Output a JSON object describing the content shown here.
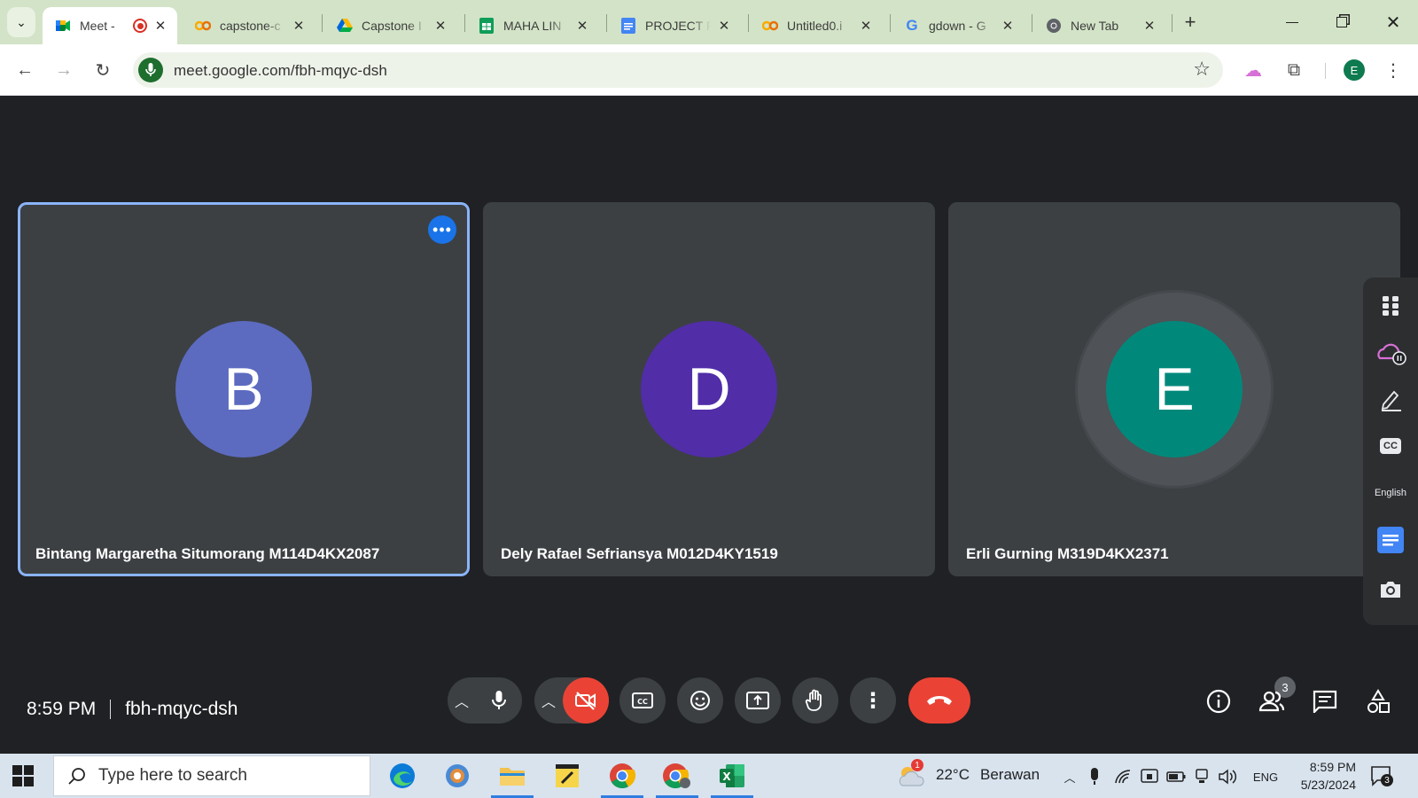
{
  "browser": {
    "tabs": [
      {
        "title": "Meet - ",
        "icon": "google-meet-icon",
        "active": true
      },
      {
        "title": "capstone-c",
        "icon": "colab-icon"
      },
      {
        "title": "Capstone I",
        "icon": "google-drive-icon"
      },
      {
        "title": "MAHA LIN",
        "icon": "google-sheets-icon"
      },
      {
        "title": "PROJECT P",
        "icon": "google-docs-icon"
      },
      {
        "title": "Untitled0.i",
        "icon": "colab-icon"
      },
      {
        "title": "gdown - G",
        "icon": "google-icon"
      },
      {
        "title": "New Tab",
        "icon": "chrome-icon"
      }
    ],
    "url": "meet.google.com/fbh-mqyc-dsh",
    "profile_initial": "E"
  },
  "meet": {
    "participants": [
      {
        "initial": "B",
        "name": "Bintang Margaretha Situmorang M114D4KX2087",
        "color": "#5c6bc0",
        "speaking": true
      },
      {
        "initial": "D",
        "name": "Dely Rafael Sefriansya M012D4KY1519",
        "color": "#512da8"
      },
      {
        "initial": "E",
        "name": "Erli Gurning M319D4KX2371",
        "color": "#00897b"
      }
    ],
    "side_panel": {
      "language": "English"
    },
    "time": "8:59 PM",
    "meeting_code": "fbh-mqyc-dsh",
    "people_count": "3"
  },
  "taskbar": {
    "search_placeholder": "Type here to search",
    "weather_temp": "22°C",
    "weather_text": "Berawan",
    "weather_alert": "1",
    "language": "ENG",
    "time": "8:59 PM",
    "date": "5/23/2024",
    "notification_count": "3"
  },
  "colors": {
    "tab_strip": "#d3e3c7",
    "meet_background": "#202124",
    "tile_background": "#3c4043",
    "accent_red": "#ea4335",
    "accent_blue": "#1a73e8",
    "taskbar": "#d8e3ee"
  }
}
